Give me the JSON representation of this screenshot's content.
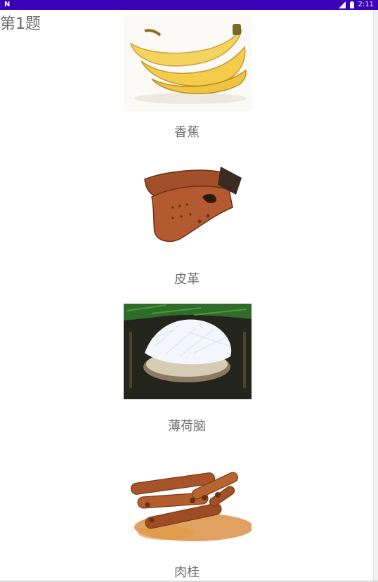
{
  "status_bar": {
    "left_icon": "n-notification-icon",
    "time": "2:11",
    "icons": [
      "signal-icon",
      "battery-icon"
    ],
    "background": "#3a00b8"
  },
  "page": {
    "title": "第1题"
  },
  "items": [
    {
      "label": "香蕉",
      "image_icon": "banana-image"
    },
    {
      "label": "皮革",
      "image_icon": "leather-gloves-image"
    },
    {
      "label": "薄荷脑",
      "image_icon": "menthol-crystals-image"
    },
    {
      "label": "肉桂",
      "image_icon": "cinnamon-sticks-image"
    }
  ]
}
